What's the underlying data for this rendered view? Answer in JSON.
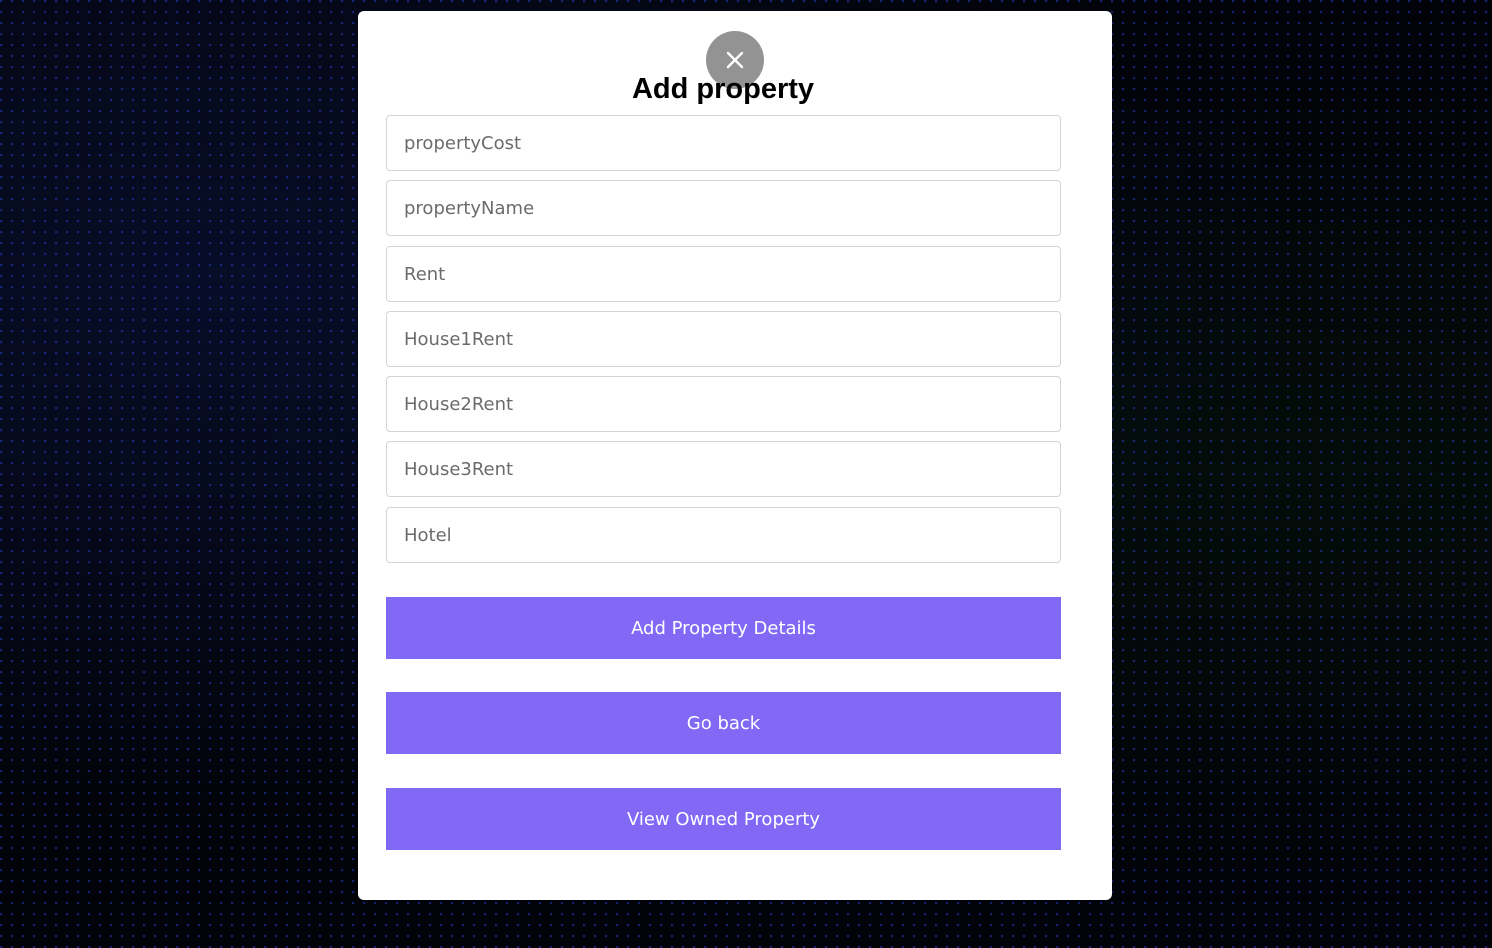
{
  "modal": {
    "title": "Add property",
    "close_icon": "close-icon"
  },
  "form": {
    "fields": [
      {
        "name": "property-cost",
        "placeholder": "propertyCost",
        "value": ""
      },
      {
        "name": "property-name",
        "placeholder": "propertyName",
        "value": ""
      },
      {
        "name": "rent",
        "placeholder": "Rent",
        "value": ""
      },
      {
        "name": "house1-rent",
        "placeholder": "House1Rent",
        "value": ""
      },
      {
        "name": "house2-rent",
        "placeholder": "House2Rent",
        "value": ""
      },
      {
        "name": "house3-rent",
        "placeholder": "House3Rent",
        "value": ""
      },
      {
        "name": "hotel",
        "placeholder": "Hotel",
        "value": ""
      }
    ]
  },
  "buttons": {
    "add_details": "Add Property Details",
    "go_back": "Go back",
    "view_owned": "View Owned Property"
  },
  "colors": {
    "button_bg": "#8169f6",
    "button_text": "#ffffff",
    "close_bg": "#808080"
  }
}
